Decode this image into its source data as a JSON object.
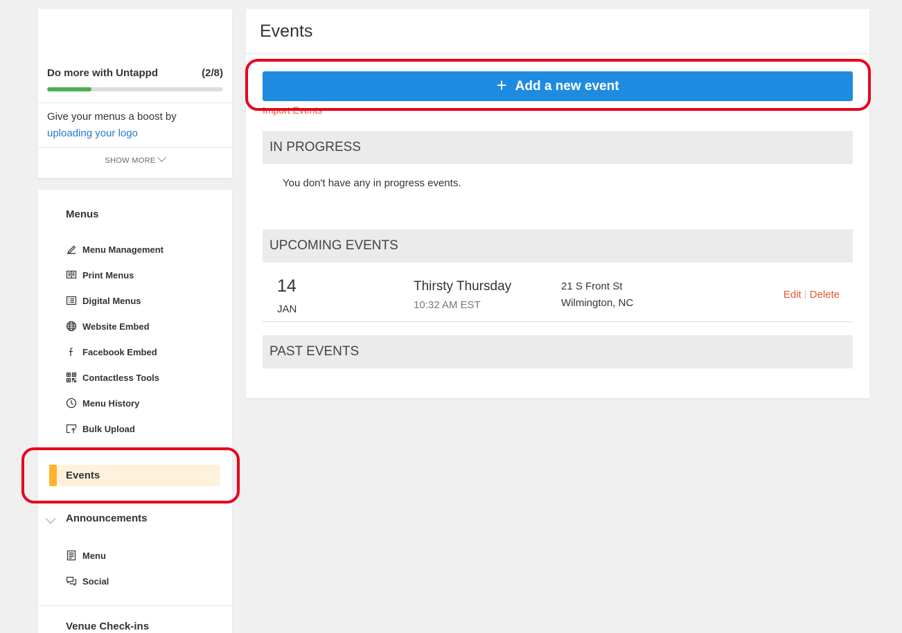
{
  "onboarding": {
    "title": "Do more with Untappd",
    "count": "(2/8)",
    "progress_fraction": 0.25,
    "tip_text": "Give your menus a boost by ",
    "tip_link": "uploading your logo",
    "show_more": "SHOW MORE"
  },
  "nav": {
    "menus_section": "Menus",
    "menu_items": [
      {
        "label": "Menu Management",
        "icon": "pencil-icon"
      },
      {
        "label": "Print Menus",
        "icon": "book-icon"
      },
      {
        "label": "Digital Menus",
        "icon": "list-screen-icon"
      },
      {
        "label": "Website Embed",
        "icon": "globe-icon"
      },
      {
        "label": "Facebook Embed",
        "icon": "facebook-icon"
      },
      {
        "label": "Contactless Tools",
        "icon": "qr-code-icon"
      },
      {
        "label": "Menu History",
        "icon": "clock-icon"
      },
      {
        "label": "Bulk Upload",
        "icon": "upload-icon"
      }
    ],
    "events_label": "Events",
    "announcements_section": "Announcements",
    "announcement_items": [
      {
        "label": "Menu",
        "icon": "menu-doc-icon"
      },
      {
        "label": "Social",
        "icon": "chat-icon"
      }
    ],
    "checkins_section": "Venue Check-ins"
  },
  "main": {
    "title": "Events",
    "add_button": "Add a new event",
    "add_icon": "+",
    "import_link": "Import Events",
    "in_progress": {
      "heading": "IN PROGRESS",
      "empty": "You don't have any in progress events."
    },
    "upcoming": {
      "heading": "UPCOMING EVENTS",
      "events": [
        {
          "day": "14",
          "month": "JAN",
          "name": "Thirsty Thursday",
          "time": "10:32 AM EST",
          "address_line1": "21 S Front St",
          "address_line2": "Wilmington, NC",
          "edit": "Edit",
          "delete": "Delete"
        }
      ]
    },
    "past": {
      "heading": "PAST EVENTS"
    }
  },
  "colors": {
    "primary_button": "#1f8be0",
    "action_link": "#e8572a",
    "active_nav_bg": "#fff1dc",
    "active_nav_bar": "#ffb42b",
    "progress": "#4caf50",
    "highlight_ring": "#e8001c"
  }
}
